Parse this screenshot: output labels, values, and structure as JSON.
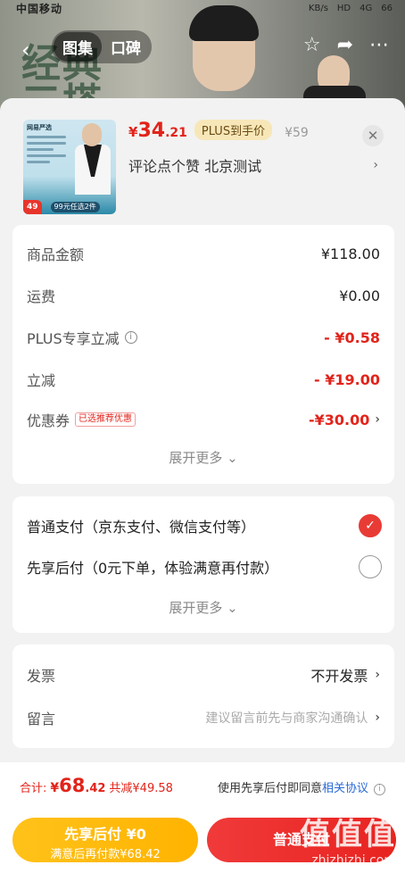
{
  "background": {
    "statusbar_left": "中国移动",
    "statusbar_right": [
      "KB/s",
      "HD",
      "4G",
      "66"
    ],
    "tabs": [
      "图集",
      "口碑"
    ],
    "active_tab": 0,
    "big_text": "经典\n三搭"
  },
  "product": {
    "image_brand": "网易严选",
    "image_price": "49",
    "image_deal": "99元任选2件",
    "price_symbol": "¥",
    "price_int": "34",
    "price_dec": ".21",
    "plus_badge": "PLUS到手价",
    "original_price": "¥59",
    "spec": "评论点个赞  北京测试"
  },
  "amounts": [
    {
      "label": "商品金额",
      "value": "¥118.00",
      "style": "normal"
    },
    {
      "label": "运费",
      "value": "¥0.00",
      "style": "normal"
    },
    {
      "label": "PLUS专享立减",
      "value": "- ¥0.58",
      "style": "red"
    },
    {
      "label": "立减",
      "value": "- ¥19.00",
      "style": "red"
    },
    {
      "label": "优惠券",
      "tag": "已选推荐优惠",
      "value": "-¥30.00",
      "style": "red"
    }
  ],
  "expand_more": "展开更多",
  "payment": {
    "options": [
      {
        "label": "普通支付（京东支付、微信支付等）",
        "selected": true
      },
      {
        "label": "先享后付（0元下单，体验满意再付款）",
        "selected": false
      }
    ]
  },
  "invoice": {
    "label": "发票",
    "value": "不开发票"
  },
  "message": {
    "label": "留言",
    "placeholder": "建议留言前先与商家沟通确认"
  },
  "summary": {
    "label": "合计:",
    "symbol": "¥",
    "int": "68",
    "dec": ".42",
    "saved": "共减¥49.58",
    "agree_text": "使用先享后付即同意",
    "agree_link": "相关协议"
  },
  "buttons": {
    "later_title": "先享后付 ¥0",
    "later_sub": "满意后再付款¥68.42",
    "pay": "普通支付"
  },
  "watermark": {
    "line1": "值值值",
    "line2": "zhizhizhi.com"
  },
  "colors": {
    "accent_red": "#e2231a",
    "plus_gold": "#f7e7b8",
    "later_yellow": "#ffb300"
  }
}
